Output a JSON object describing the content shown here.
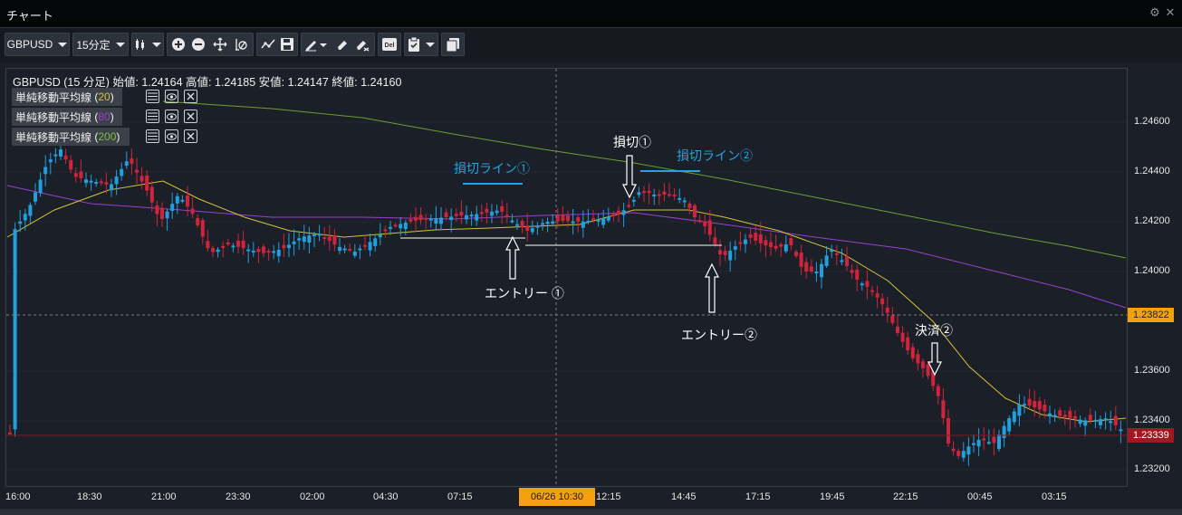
{
  "window": {
    "title": "チャート"
  },
  "toolbar": {
    "symbol": "GBPUSD",
    "timeframe": "15分定"
  },
  "info": {
    "symbol_label": "GBPUSD (15 分足)",
    "ohlc": "始値: 1.24164 高値: 1.24185 安値: 1.24147 終値: 1.24160"
  },
  "indicators": [
    {
      "name": "単純移動平均線",
      "period": "20",
      "color": "#d4c43a"
    },
    {
      "name": "単純移動平均線",
      "period": "80",
      "color": "#9b3fd0"
    },
    {
      "name": "単純移動平均線",
      "period": "200",
      "color": "#7fbf3a"
    }
  ],
  "price_axis": [
    "1.24600",
    "1.24400",
    "1.24200",
    "1.24000",
    "1.23600",
    "1.23400",
    "1.23200"
  ],
  "price_tags": {
    "cursor": "1.23822",
    "last": "1.23339"
  },
  "time_axis": [
    "16:00",
    "18:30",
    "21:00",
    "23:30",
    "02:00",
    "04:30",
    "07:15",
    "12:15",
    "14:45",
    "17:15",
    "19:45",
    "22:15",
    "00:45",
    "03:15"
  ],
  "time_cursor": "06/26 10:30",
  "annotations": {
    "stoploss_line_1": "損切ライン①",
    "stoploss_1": "損切①",
    "stoploss_line_2": "損切ライン②",
    "entry_1": "エントリー ①",
    "entry_2": "エントリー②",
    "settle_2": "決済②"
  },
  "colors": {
    "up": "#21a0e0",
    "down": "#d0243c",
    "cursor": "#f5a10f",
    "last": "#9c1a22"
  }
}
